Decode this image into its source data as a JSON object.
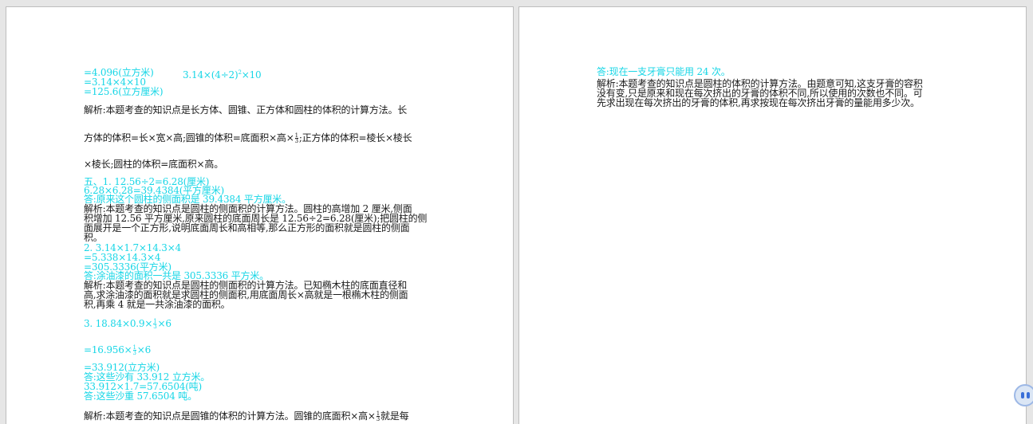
{
  "colors": {
    "answer": "#17d6e6",
    "text": "#1a1a1a",
    "viewer_bg": "#e6e6e6"
  },
  "page1": {
    "l01a": "=4.096(立方米)",
    "l01b": "3.14×(4÷2)",
    "l01b_sup": "2",
    "l01b_tail": "×10",
    "l02": "=3.14×4×10",
    "l03": "=125.6(立方厘米)",
    "p1a": "解析:本题考查的知识点是长方体、圆锥、正方体和圆柱的体积的计算方法。长",
    "p1b_pre": "方体的体积=长×宽×高;圆锥的体积=底面积×高×",
    "p1b_frac_num": "1",
    "p1b_frac_den": "3",
    "p1b_post": ";正方体的体积=棱长×棱长",
    "p1c": "×棱长;圆柱的体积=底面积×高。",
    "l10": "五、1.  12.56÷2=6.28(厘米)",
    "l11": "6.28×6.28=39.4384(平方厘米)",
    "l12": "答:原来这个圆柱的侧面积是 39.4384 平方厘米。",
    "p2a": "解析:本题考查的知识点是圆柱的侧面积的计算方法。圆柱的高增加 2 厘米,侧面",
    "p2b": "积增加 12.56 平方厘米,原来圆柱的底面周长是 12.56÷2=6.28(厘米);把圆柱的侧",
    "p2c": "面展开是一个正方形,说明底面周长和高相等,那么正方形的面积就是圆柱的侧面",
    "p2d": "积。",
    "l20": "2.   3.14×1.7×14.3×4",
    "l21": "=5.338×14.3×4",
    "l22": "=305.3336(平方米)",
    "l23": "答:涂油漆的面积一共是 305.3336 平方米。",
    "p3a": "解析:本题考查的知识点是圆柱的侧面积的计算方法。已知椭木柱的底面直径和",
    "p3b": "高,求涂油漆的面积就是求圆柱的侧面积,用底面周长×高就是一根椭木柱的侧面",
    "p3c": "积,再乘 4 就是一共涂油漆的面积。",
    "l30_pre": "3.   18.84×0.9×",
    "l30_num": "1",
    "l30_den": "3",
    "l30_post": "×6",
    "l31_pre": "=16.956×",
    "l31_num": "1",
    "l31_den": "3",
    "l31_post": "×6",
    "l32": "=33.912(立方米)",
    "l33": "答:这些沙有 33.912 立方米。",
    "l34": "33.912×1.7=57.6504(吨)",
    "l35": "答:这些沙重 57.6504 吨。",
    "p4a_pre": "解析:本题考查的知识点是圆锥的体积的计算方法。圆锥的底面积×高×",
    "p4a_num": "1",
    "p4a_den": "3",
    "p4a_post": "就是每"
  },
  "page2": {
    "l01": "答:现在一支牙膏只能用 24 次。",
    "p1a": "解析:本题考查的知识点是圆柱的体积的计算方法。由题意可知,这支牙膏的容积",
    "p1b": "没有变,只是原来和现在每次挤出的牙膏的体积不同,所以使用的次数也不同。可",
    "p1c": "先求出现在每次挤出的牙膏的体积,再求按现在每次挤出牙膏的量能用多少次。"
  }
}
